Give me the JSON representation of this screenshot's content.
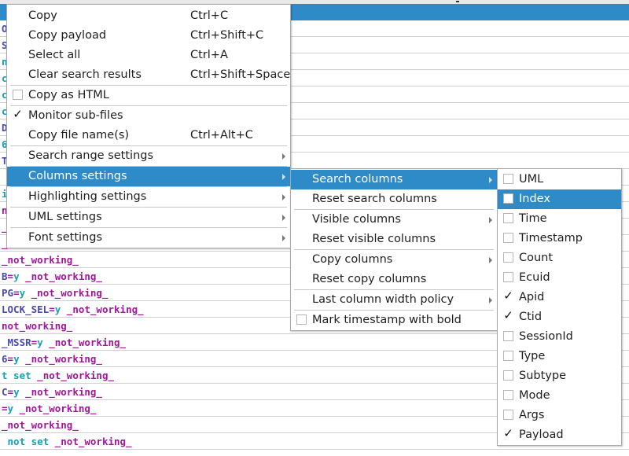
{
  "log_table": {
    "rows": [
      {
        "selected": true,
        "segments": []
      },
      {
        "segments": [
          {
            "t": "O",
            "c": "key"
          }
        ]
      },
      {
        "segments": [
          {
            "t": "S",
            "c": "key"
          }
        ]
      },
      {
        "segments": [
          {
            "t": "n",
            "c": "val"
          }
        ]
      },
      {
        "segments": [
          {
            "t": "c",
            "c": "val"
          }
        ]
      },
      {
        "segments": [
          {
            "t": "c",
            "c": "val"
          }
        ]
      },
      {
        "segments": [
          {
            "t": "c",
            "c": "val"
          }
        ]
      },
      {
        "segments": [
          {
            "t": "D",
            "c": "key"
          }
        ]
      },
      {
        "segments": [
          {
            "t": "6",
            "c": "val"
          }
        ]
      },
      {
        "segments": [
          {
            "t": "T",
            "c": "key"
          }
        ]
      },
      {
        "segments": []
      },
      {
        "segments": [
          {
            "t": "i",
            "c": "val"
          }
        ]
      },
      {
        "segments": [
          {
            "t": "n",
            "c": "txt"
          }
        ]
      },
      {
        "segments": [
          {
            "t": "_",
            "c": "txt"
          }
        ]
      },
      {
        "segments": [
          {
            "t": "_",
            "c": "txt"
          }
        ]
      },
      {
        "segments": [
          {
            "t": "_not_working_",
            "c": "txt"
          }
        ]
      },
      {
        "segments": [
          {
            "t": "B",
            "c": "key"
          },
          {
            "t": "=",
            "c": "eq"
          },
          {
            "t": "y",
            "c": "val"
          },
          {
            "t": " _not_working_",
            "c": "txt"
          }
        ]
      },
      {
        "segments": [
          {
            "t": "PG",
            "c": "key"
          },
          {
            "t": "=",
            "c": "eq"
          },
          {
            "t": "y",
            "c": "val"
          },
          {
            "t": " _not_working_",
            "c": "txt"
          }
        ]
      },
      {
        "segments": [
          {
            "t": "LOCK_SEL",
            "c": "key"
          },
          {
            "t": "=",
            "c": "eq"
          },
          {
            "t": "y",
            "c": "val"
          },
          {
            "t": " _not_working_",
            "c": "txt"
          }
        ]
      },
      {
        "segments": [
          {
            "t": "not_working_",
            "c": "txt"
          }
        ]
      },
      {
        "segments": [
          {
            "t": "_MSSR",
            "c": "key"
          },
          {
            "t": "=",
            "c": "eq"
          },
          {
            "t": "y",
            "c": "val"
          },
          {
            "t": " _not_working_",
            "c": "txt"
          }
        ]
      },
      {
        "segments": [
          {
            "t": "6",
            "c": "key"
          },
          {
            "t": "=",
            "c": "eq"
          },
          {
            "t": "y",
            "c": "val"
          },
          {
            "t": " _not_working_",
            "c": "txt"
          }
        ]
      },
      {
        "segments": [
          {
            "t": "t set",
            "c": "val"
          },
          {
            "t": " _not_working_",
            "c": "txt"
          }
        ]
      },
      {
        "segments": [
          {
            "t": "C",
            "c": "key"
          },
          {
            "t": "=",
            "c": "eq"
          },
          {
            "t": "y",
            "c": "val"
          },
          {
            "t": " _not_working_",
            "c": "txt"
          }
        ]
      },
      {
        "segments": [
          {
            "t": "=",
            "c": "eq"
          },
          {
            "t": "y",
            "c": "val"
          },
          {
            "t": " _not_working_",
            "c": "txt"
          }
        ]
      },
      {
        "segments": [
          {
            "t": "_not_working_",
            "c": "txt"
          }
        ]
      },
      {
        "segments": [
          {
            "t": " not set",
            "c": "val"
          },
          {
            "t": " _not_working_",
            "c": "txt"
          }
        ]
      }
    ]
  },
  "context_menu": {
    "items": [
      {
        "label": "Copy",
        "shortcut": "Ctrl+C"
      },
      {
        "label": "Copy payload",
        "shortcut": "Ctrl+Shift+C"
      },
      {
        "label": "Select all",
        "shortcut": "Ctrl+A"
      },
      {
        "label": "Clear search results",
        "shortcut": "Ctrl+Shift+Space"
      },
      {
        "label": "Copy as HTML",
        "checked": false
      },
      {
        "label": "Monitor sub-files",
        "checked": true
      },
      {
        "label": "Copy file name(s)",
        "shortcut": "Ctrl+Alt+C"
      },
      {
        "label": "Search range settings"
      },
      {
        "label": "Columns settings"
      },
      {
        "label": "Highlighting settings"
      },
      {
        "label": "UML settings"
      },
      {
        "label": "Font settings"
      }
    ]
  },
  "columns_submenu": {
    "items": [
      {
        "label": "Search columns"
      },
      {
        "label": "Reset search columns"
      },
      {
        "label": "Visible columns"
      },
      {
        "label": "Reset visible columns"
      },
      {
        "label": "Copy columns"
      },
      {
        "label": "Reset copy columns"
      },
      {
        "label": "Last column width policy"
      },
      {
        "label": "Mark timestamp with bold",
        "checked": false
      }
    ]
  },
  "search_columns_submenu": {
    "items": [
      {
        "label": "UML",
        "checked": false
      },
      {
        "label": "Index",
        "checked": false
      },
      {
        "label": "Time",
        "checked": false
      },
      {
        "label": "Timestamp",
        "checked": false
      },
      {
        "label": "Count",
        "checked": false
      },
      {
        "label": "Ecuid",
        "checked": false
      },
      {
        "label": "Apid",
        "checked": true
      },
      {
        "label": "Ctid",
        "checked": true
      },
      {
        "label": "SessionId",
        "checked": false
      },
      {
        "label": "Type",
        "checked": false
      },
      {
        "label": "Subtype",
        "checked": false
      },
      {
        "label": "Mode",
        "checked": false
      },
      {
        "label": "Args",
        "checked": false
      },
      {
        "label": "Payload",
        "checked": true
      }
    ]
  },
  "glyphs": {
    "check": "✓"
  }
}
